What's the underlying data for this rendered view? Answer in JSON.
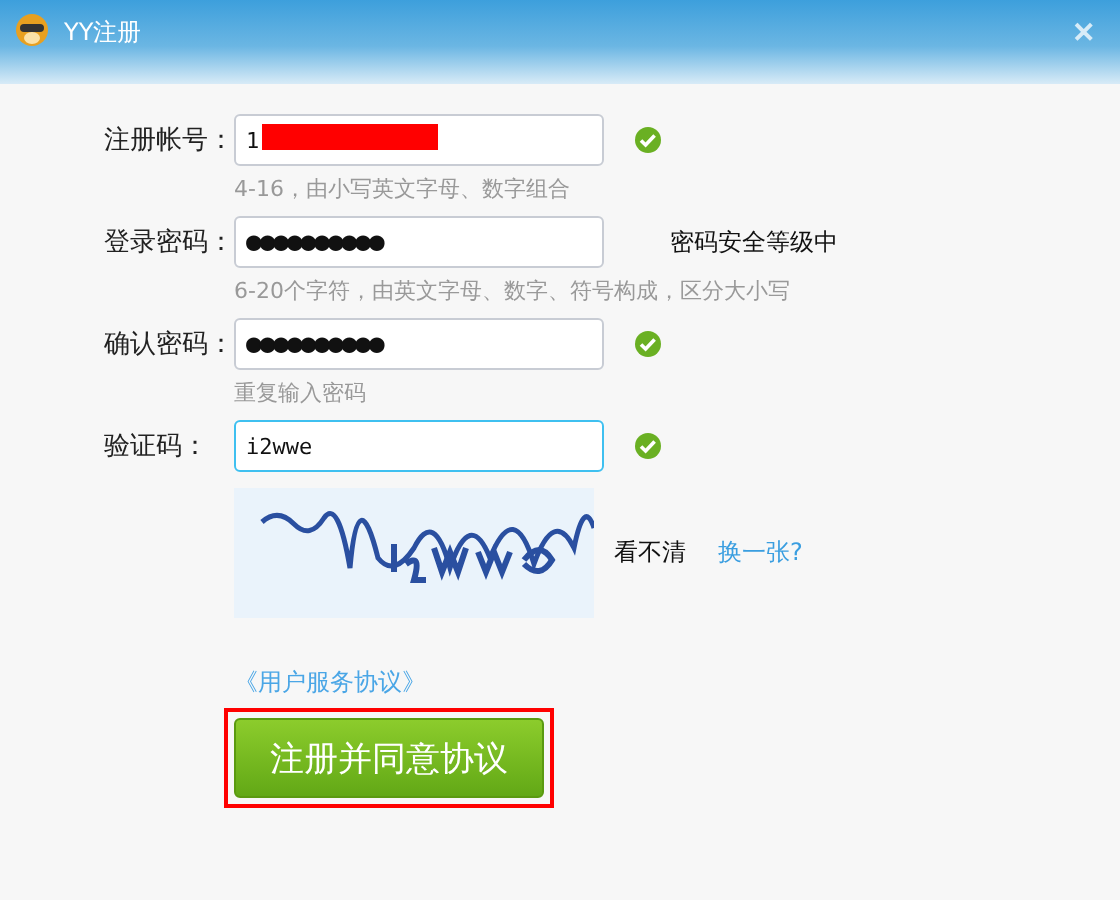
{
  "window": {
    "title": "YY注册",
    "close": "✕"
  },
  "fields": [
    {
      "label": "注册帐号：",
      "value": "1",
      "redacted": true,
      "focused": false,
      "valid": true,
      "hint": "4-16，由小写英文字母、数字组合"
    },
    {
      "label": "登录密码：",
      "value": "●●●●●●●●●●",
      "redacted": false,
      "focused": false,
      "valid": false,
      "strength": "密码安全等级中",
      "hint": "6-20个字符，由英文字母、数字、符号构成，区分大小写"
    },
    {
      "label": "确认密码：",
      "value": "●●●●●●●●●●",
      "redacted": false,
      "focused": false,
      "valid": true,
      "hint": "重复输入密码"
    },
    {
      "label": "验证码：",
      "value": "i2wwe",
      "redacted": false,
      "focused": true,
      "valid": true
    }
  ],
  "captcha": {
    "unclear": "看不清",
    "refresh": "换一张?"
  },
  "agreement_link": "《用户服务协议》",
  "submit": {
    "label": "注册并同意协议",
    "highlighted": true
  }
}
